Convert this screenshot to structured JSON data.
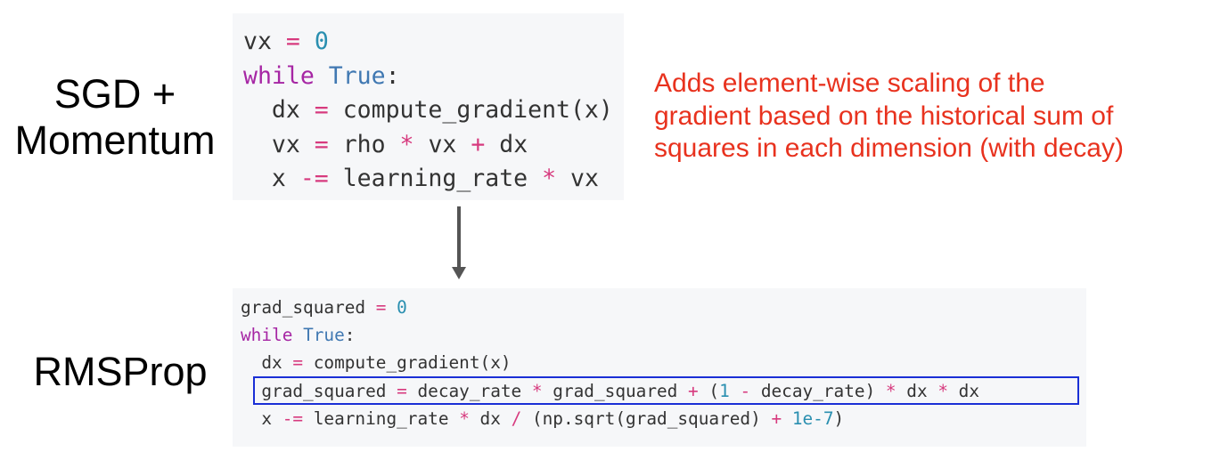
{
  "labels": {
    "sgd_line1": "SGD +",
    "sgd_line2": "Momentum",
    "rmsprop": "RMSProp"
  },
  "description": {
    "line1": "Adds element-wise scaling of the",
    "line2": "gradient based on the historical sum of",
    "line3": "squares in each dimension (with decay)"
  },
  "sgd_code": {
    "l1_a": "vx ",
    "l1_op": "=",
    "l1_num": "0",
    "l2_kw": "while",
    "l2_bi": "True",
    "l2_rest": ":",
    "l3_a": "  dx ",
    "l3_op": "=",
    "l3_b": " compute_gradient(x)",
    "l4_a": "  vx ",
    "l4_op1": "=",
    "l4_b": " rho ",
    "l4_op2": "*",
    "l4_c": " vx ",
    "l4_op3": "+",
    "l4_d": " dx",
    "l5_a": "  x ",
    "l5_op1": "-=",
    "l5_b": " learning_rate ",
    "l5_op2": "*",
    "l5_c": " vx"
  },
  "rms_code": {
    "l1_a": "grad_squared ",
    "l1_op": "=",
    "l1_num": "0",
    "l2_kw": "while",
    "l2_bi": "True",
    "l2_rest": ":",
    "l3_a": "  dx ",
    "l3_op": "=",
    "l3_b": " compute_gradient(x)",
    "l4_a": "  grad_squared ",
    "l4_op1": "=",
    "l4_b": " decay_rate ",
    "l4_op2": "*",
    "l4_c": " grad_squared ",
    "l4_op3": "+",
    "l4_d": " (",
    "l4_num": "1",
    "l4_e": " ",
    "l4_op4": "-",
    "l4_f": " decay_rate) ",
    "l4_op5": "*",
    "l4_g": " dx ",
    "l4_op6": "*",
    "l4_h": " dx",
    "l5_a": "  x ",
    "l5_op1": "-=",
    "l5_b": " learning_rate ",
    "l5_op2": "*",
    "l5_c": " dx ",
    "l5_op3": "/",
    "l5_d": " (np.sqrt(grad_squared) ",
    "l5_op4": "+",
    "l5_e": " ",
    "l5_num": "1e-7",
    "l5_f": ")"
  },
  "colors": {
    "description_text": "#e8321e",
    "highlight_border": "#1a2fd6",
    "code_background": "#f6f7f9",
    "arrow": "#555555"
  },
  "icons": {
    "arrow": "down-arrow-icon"
  }
}
